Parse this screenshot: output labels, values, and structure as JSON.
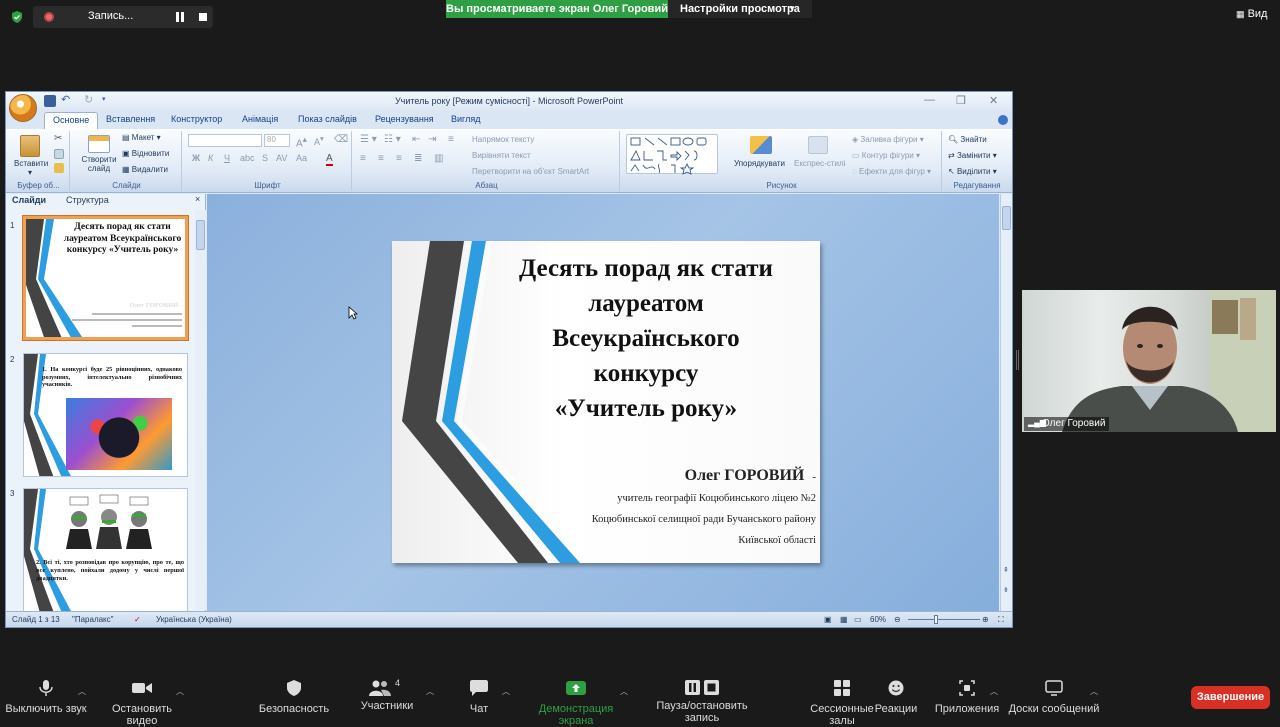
{
  "zoom": {
    "recording_label": "Запись...",
    "share_banner": "Вы просматриваете экран Олег Горовий",
    "view_settings": "Настройки просмотра",
    "view_button": "Вид",
    "participant_name": "Олег Горовий",
    "participants_count": "4",
    "toolbar": {
      "mute": "Выключить звук",
      "video": "Остановить видео",
      "security": "Безопасность",
      "participants": "Участники",
      "chat": "Чат",
      "share": "Демонстрация экрана",
      "pause_record": "Пауза/остановить запись",
      "breakout": "Сессионные залы",
      "reactions": "Реакции",
      "apps": "Приложения",
      "whiteboard": "Доски сообщений",
      "end": "Завершение"
    },
    "colors": {
      "green": "#2ea043",
      "end_red": "#d93025"
    }
  },
  "ppt": {
    "window_title": "Учитель року [Режим сумісності] - Microsoft PowerPoint",
    "tabs": [
      "Основне",
      "Вставлення",
      "Конструктор",
      "Анімація",
      "Показ слайдів",
      "Рецензування",
      "Вигляд"
    ],
    "active_tab": "Основне",
    "ribbon": {
      "clipboard": {
        "paste": "Вставити",
        "label": "Буфер об..."
      },
      "slides": {
        "new_slide": "Створити слайд",
        "layout": "Макет",
        "reset": "Відновити",
        "delete": "Видалити",
        "label": "Слайди"
      },
      "font": {
        "size": "80",
        "label": "Шрифт"
      },
      "paragraph": {
        "text_direction": "Напрямок тексту",
        "align_text": "Вирівняти текст",
        "smartart": "Перетворити на об'єкт SmartArt",
        "label": "Абзац"
      },
      "drawing": {
        "arrange": "Упорядкувати",
        "quick_styles": "Експрес-стилі",
        "shape_fill": "Заливка фігури",
        "shape_outline": "Контур фігури",
        "shape_effects": "Ефекти для фігур",
        "label": "Рисунок"
      },
      "editing": {
        "find": "Знайти",
        "replace": "Замінити",
        "select": "Виділити",
        "label": "Редагування"
      }
    },
    "pane_tabs": [
      "Слайди",
      "Структура"
    ],
    "thumbs": [
      {
        "num": "1",
        "title": "Десять порад як стати лауреатом Всеукраїнського конкурсу «Учитель року»",
        "author": "Олег ГОРОВИЙ -"
      },
      {
        "num": "2",
        "text": "1. На конкурсі буде 25 рівноцінних, однаково розумних, інтелектуально різнобічних учасників."
      },
      {
        "num": "3",
        "text": "2. Всі ті, хто розповідав про корупцію, про те, що все куплено, пойхали додому у числі першої двадцятки."
      }
    ],
    "slide": {
      "title_lines": [
        "Десять порад як стати",
        "лауреатом",
        "Всеукраїнського",
        "конкурсу",
        "«Учитель року»"
      ],
      "author": "Олег ГОРОВИЙ",
      "author_dash": "-",
      "sub_lines": [
        "учитель географії Коцюбинського ліцею №2",
        "Коцюбинської селищної ради Бучанського району",
        "Київської області"
      ]
    },
    "status": {
      "slide_counter": "Слайд 1 з 13",
      "theme": "\"Паралакс\"",
      "language": "Українська (Україна)",
      "zoom": "60%"
    }
  }
}
